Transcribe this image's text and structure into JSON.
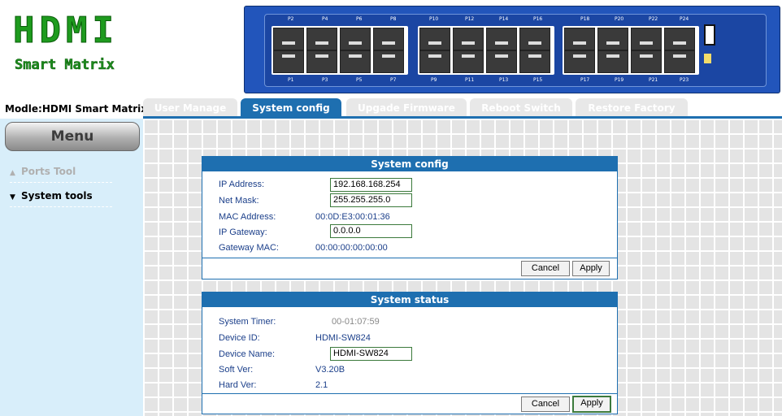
{
  "logo": {
    "title": "HDMI",
    "subtitle": "Smart Matrix"
  },
  "switch_labels": {
    "top": [
      "P2",
      "P4",
      "P6",
      "P8",
      "P10",
      "P12",
      "P14",
      "P16",
      "P18",
      "P20",
      "P22",
      "P24"
    ],
    "bottom": [
      "P1",
      "P3",
      "P5",
      "P7",
      "P9",
      "P11",
      "P13",
      "P15",
      "P17",
      "P19",
      "P21",
      "P23"
    ]
  },
  "model": "Modle:HDMI Smart Matrix",
  "tabs": [
    {
      "label": "User Manage",
      "active": false
    },
    {
      "label": "System config",
      "active": true
    },
    {
      "label": "Upgade Firmware",
      "active": false
    },
    {
      "label": "Reboot Switch",
      "active": false
    },
    {
      "label": "Restore Factory",
      "active": false
    }
  ],
  "sidebar": {
    "menu_label": "Menu",
    "items": [
      {
        "label": "Ports Tool",
        "enabled": false
      },
      {
        "label": "System tools",
        "enabled": true
      }
    ]
  },
  "system_config": {
    "title": "System config",
    "ip_label": "IP Address:",
    "ip_value": "192.168.168.254",
    "mask_label": "Net Mask:",
    "mask_value": "255.255.255.0",
    "mac_label": "MAC Address:",
    "mac_value": "00:0D:E3:00:01:36",
    "gateway_label": "IP Gateway:",
    "gateway_value": "0.0.0.0",
    "gwmac_label": "Gateway MAC:",
    "gwmac_value": "00:00:00:00:00:00",
    "cancel_label": "Cancel",
    "apply_label": "Apply"
  },
  "system_status": {
    "title": "System status",
    "timer_label": "System Timer:",
    "timer_value": "00-01:07:59",
    "device_id_label": "Device ID:",
    "device_id_value": "HDMI-SW824",
    "device_name_label": "Device Name:",
    "device_name_value": "HDMI-SW824",
    "soft_label": "Soft Ver:",
    "soft_value": "V3.20B",
    "hard_label": "Hard Ver:",
    "hard_value": "2.1",
    "cancel_label": "Cancel",
    "apply_label": "Apply"
  },
  "colors": {
    "accent": "#1e6fb0",
    "logo_green": "#1e9b1e",
    "sidebar_bg": "#d8eefa"
  }
}
